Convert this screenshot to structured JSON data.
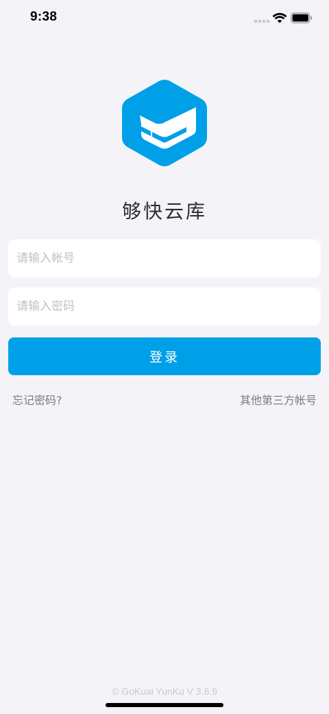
{
  "status_bar": {
    "time": "9:38"
  },
  "app": {
    "name": "够快云库",
    "brand_color": "#00a0e9"
  },
  "login_form": {
    "account_placeholder": "请输入帐号",
    "password_placeholder": "请输入密码",
    "login_label": "登录",
    "forgot_password_label": "忘记密码?",
    "third_party_label": "其他第三方帐号"
  },
  "footer": {
    "version_text": "© GoKuai YunKu V 3.6.9"
  },
  "icons": {
    "status": [
      "signal-dots-icon",
      "wifi-icon",
      "battery-icon"
    ],
    "logo": "gokuai-cube-logo-icon"
  }
}
